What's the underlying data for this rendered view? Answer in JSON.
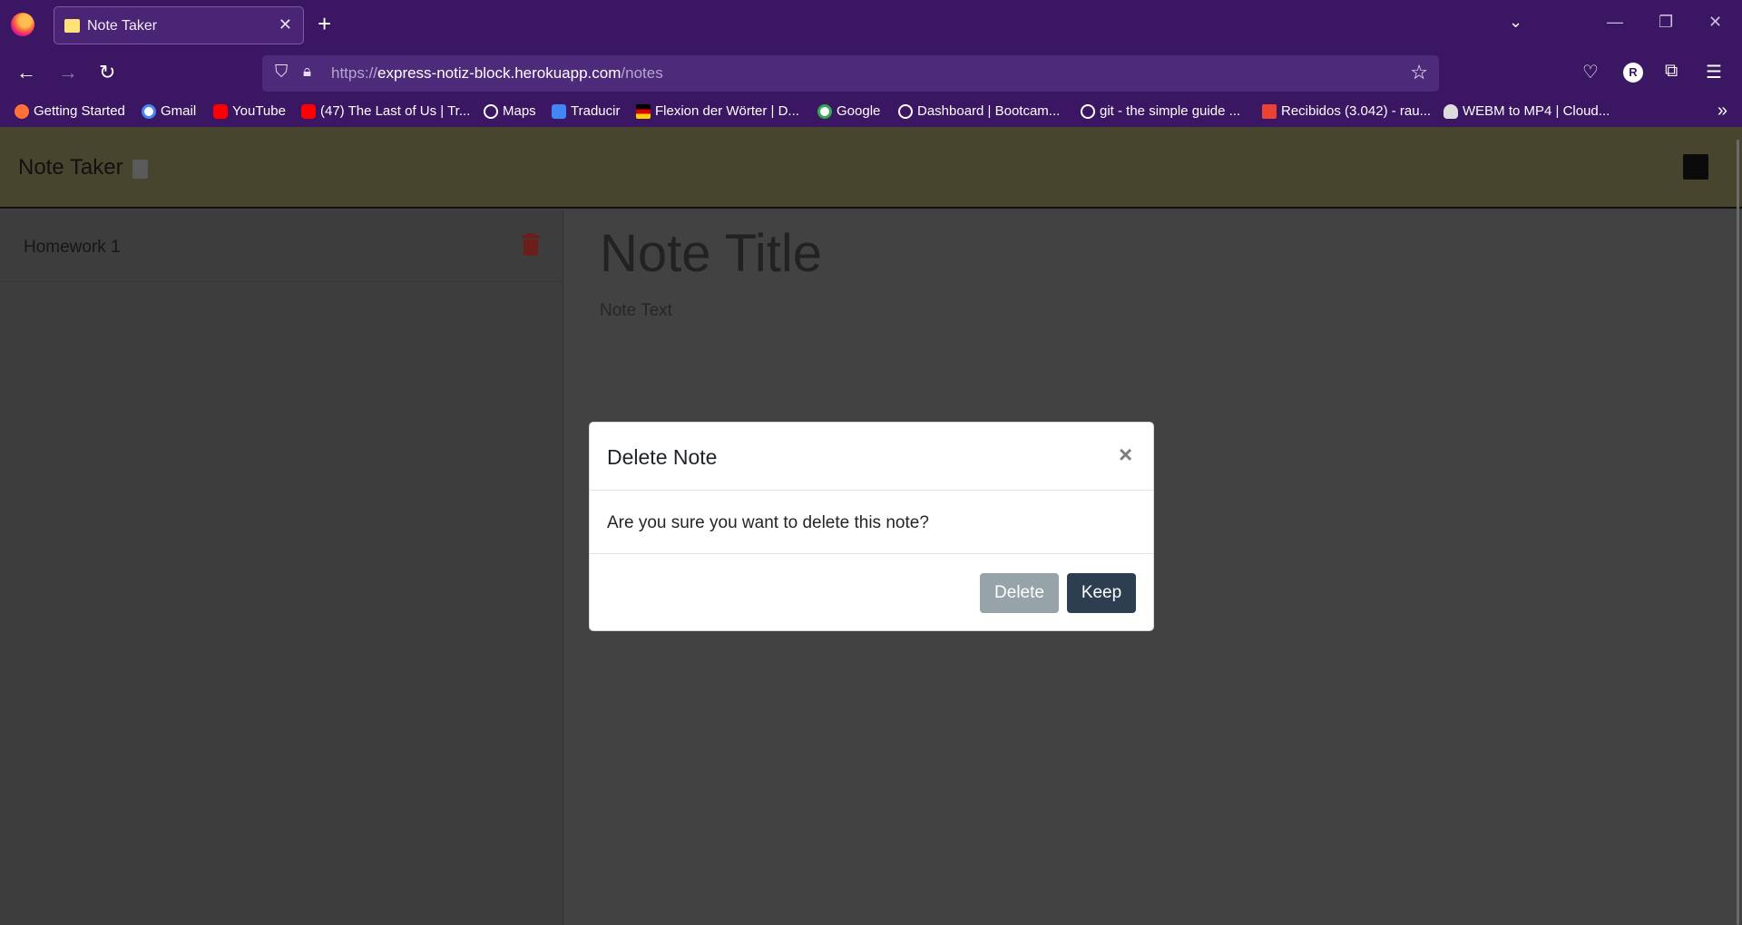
{
  "browser": {
    "tab_title": "Note Taker",
    "url_scheme": "https://",
    "url_host": "express-notiz-block.herokuapp.com",
    "url_path": "/notes",
    "bookmarks": [
      {
        "label": "Getting Started",
        "icon": "firefox-icon"
      },
      {
        "label": "Gmail",
        "icon": "google-icon"
      },
      {
        "label": "YouTube",
        "icon": "youtube-icon"
      },
      {
        "label": "(47) The Last of Us | Tr...",
        "icon": "youtube-icon"
      },
      {
        "label": "Maps",
        "icon": "globe-icon"
      },
      {
        "label": "Traducir",
        "icon": "translate-icon"
      },
      {
        "label": "Flexion der Wörter | D...",
        "icon": "flag-icon"
      },
      {
        "label": "Google",
        "icon": "google-icon"
      },
      {
        "label": "Dashboard | Bootcam...",
        "icon": "globe-icon"
      },
      {
        "label": "git - the simple guide ...",
        "icon": "globe-icon"
      },
      {
        "label": "Recibidos (3.042) - rau...",
        "icon": "gmail-icon"
      },
      {
        "label": "WEBM to MP4 | Cloud...",
        "icon": "cloud-icon"
      }
    ],
    "profile_initial": "R"
  },
  "app": {
    "title": "Note Taker"
  },
  "notes": [
    {
      "title": "Homework 1"
    }
  ],
  "editor": {
    "title_placeholder": "Note Title",
    "text_placeholder": "Note Text"
  },
  "modal": {
    "title": "Delete Note",
    "close_glyph": "×",
    "message": "Are you sure you want to delete this note?",
    "delete_label": "Delete",
    "keep_label": "Keep"
  },
  "colors": {
    "browser_chrome": "#3b1662",
    "header_bg": "#48452f",
    "delete_button": "#96a3a8",
    "keep_button": "#2c3e50",
    "trash_icon": "#6b1e1a"
  }
}
